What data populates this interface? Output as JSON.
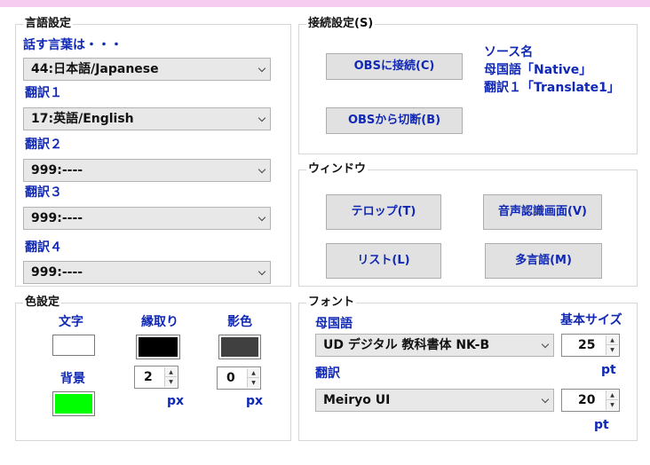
{
  "language": {
    "title": "言語設定",
    "speak_label": "話す言葉は・・・",
    "speak_value": "44:日本語/Japanese",
    "translations": [
      {
        "label": "翻訳１",
        "value": "17:英語/English"
      },
      {
        "label": "翻訳２",
        "value": "999:----"
      },
      {
        "label": "翻訳３",
        "value": "999:----"
      },
      {
        "label": "翻訳４",
        "value": "999:----"
      }
    ]
  },
  "connection": {
    "title": "接続設定(S)",
    "connect_button": "OBSに接続(C)",
    "disconnect_button": "OBSから切断(B)",
    "source_title": "ソース名",
    "source_native": "母国語「Native」",
    "source_translate": "翻訳１「Translate1」"
  },
  "window": {
    "title": "ウィンドウ",
    "telop_button": "テロップ(T)",
    "speech_screen_button": "音声認識画面(V)",
    "list_button": "リスト(L)",
    "multilang_button": "多言語(M)"
  },
  "color": {
    "title": "色設定",
    "text_label": "文字",
    "outline_label": "縁取り",
    "shadow_label": "影色",
    "background_label": "背景",
    "text_color": "#ffffff",
    "outline_color": "#000000",
    "shadow_color": "#404040",
    "background_color": "#00ff00",
    "outline_width": "2",
    "shadow_width": "0",
    "unit_px": "px"
  },
  "font": {
    "title": "フォント",
    "native_label": "母国語",
    "native_font": "UD デジタル 教科書体 NK-B",
    "base_size_label": "基本サイズ",
    "native_size": "25",
    "translation_label": "翻訳",
    "translation_font": "Meiryo UI",
    "translation_size": "20",
    "unit_pt": "pt"
  }
}
